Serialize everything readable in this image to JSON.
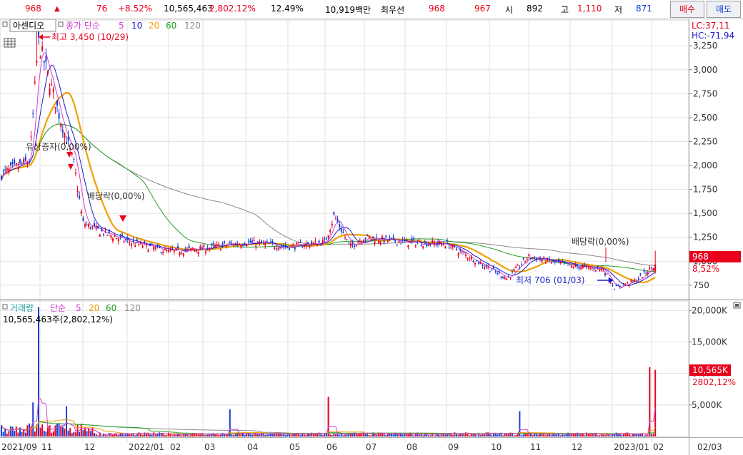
{
  "ticker": {
    "price": "968",
    "change": "76",
    "change_pct": "+8.52%",
    "volume": "10,565,463",
    "volume_ratio": "2,802.12%",
    "turnover": "12.49%",
    "trade_value": "10,919백만",
    "best_label": "최우선",
    "best_ask": "968",
    "best_bid": "967",
    "open_label": "시",
    "open": "892",
    "high_label": "고",
    "high": "1,110",
    "low_label": "저",
    "low": "871",
    "buy_label": "매수",
    "sell_label": "매도"
  },
  "price_panel": {
    "stock_name": "아센디오",
    "legend_prefix": "종가 단순",
    "ma_periods": [
      "5",
      "10",
      "20",
      "60",
      "120"
    ],
    "lc": "LC:37,11",
    "hc": "HC:-71,94",
    "max_label": "최고 3,450 (10/29)",
    "min_label": "최저 706 (01/03)",
    "rights_label": "유상증자(0,00%)",
    "dividend_label_1": "배당락(0,00%)",
    "dividend_label_2": "배당락(0,00%)",
    "last_price_tag": "968",
    "last_change_tag": "8,52%"
  },
  "volume_panel": {
    "title": "거래량",
    "legend_prefix": "단순",
    "ma_periods": [
      "5",
      "20",
      "60",
      "120"
    ],
    "summary": "10,565,463주(2,802,12%)",
    "last_volume_tag": "10,565K",
    "last_ratio_tag": "2802,12%"
  },
  "colors": {
    "up": "#e8001c",
    "down": "#1a3fd6",
    "ma5": "#d23cd2",
    "ma10": "#1c1cc8",
    "ma20": "#f0a000",
    "ma60": "#20a020",
    "ma120": "#8a8a8a"
  },
  "chart_data": [
    {
      "type": "candlestick",
      "title": "아센디오",
      "y_ticks": [
        "750",
        "1,000",
        "1,250",
        "1,500",
        "1,750",
        "2,000",
        "2,250",
        "2,500",
        "2,750",
        "3,000",
        "3,250"
      ],
      "ylim": [
        600,
        3520
      ],
      "x_ticks": [
        "2021/09",
        "11",
        "12",
        "2022/01",
        "02",
        "03",
        "04",
        "05",
        "06",
        "07",
        "08",
        "09",
        "10",
        "11",
        "12",
        "2023/01",
        "02",
        "02/03"
      ],
      "close_series_approx": {
        "dates": [
          "2021/09",
          "2021/10/15",
          "2021/10/29",
          "2021/11/15",
          "2021/11/25",
          "2021/12/01",
          "2021/12/15",
          "2022/01/03",
          "2022/02",
          "2022/03",
          "2022/04",
          "2022/05",
          "2022/06/01",
          "2022/06/08",
          "2022/06/20",
          "2022/07",
          "2022/08",
          "2022/09",
          "2022/10/15",
          "2022/11",
          "2022/12",
          "2022/12/25",
          "2023/01/03",
          "2023/01/20",
          "2023/02/03"
        ],
        "close": [
          1900,
          2050,
          3300,
          2500,
          2000,
          1400,
          1300,
          1200,
          1100,
          1130,
          1200,
          1150,
          1200,
          1480,
          1150,
          1250,
          1200,
          1180,
          820,
          1050,
          950,
          920,
          720,
          800,
          968
        ]
      },
      "annotations": [
        "최고 3,450 (10/29)",
        "최저 706 (01/03)",
        "유상증자(0,00%)",
        "배당락(0,00%)",
        "배당락(0,00%)"
      ]
    },
    {
      "type": "bar",
      "title": "거래량",
      "y_ticks": [
        "5,000K",
        "10,000K",
        "15,000K",
        "20,000K"
      ],
      "ylim": [
        0,
        21500
      ],
      "spikes_k": [
        {
          "date": "2021/10/29",
          "value": 20500
        },
        {
          "date": "2021/10/20",
          "value": 5400
        },
        {
          "date": "2021/11/20",
          "value": 4800
        },
        {
          "date": "2022/03/20",
          "value": 4300
        },
        {
          "date": "2022/06/03",
          "value": 6300
        },
        {
          "date": "2022/10/25",
          "value": 4000
        },
        {
          "date": "2023/01/30",
          "value": 11000
        },
        {
          "date": "2023/02/03",
          "value": 10565
        }
      ]
    }
  ]
}
